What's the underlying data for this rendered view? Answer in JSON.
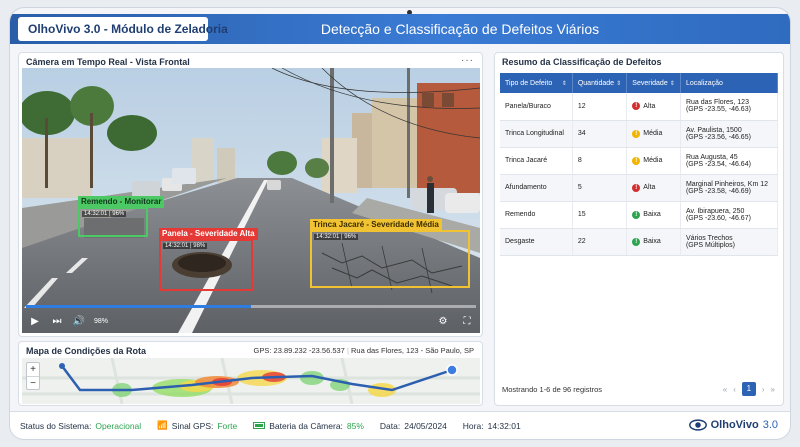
{
  "app": {
    "title": "OlhoVivo 3.0 - Módulo de Zeladoria",
    "page_title": "Detecção e Classificação de Defeitos Viários",
    "brand_name": "OlhoVivo",
    "brand_version": "3.0"
  },
  "camera": {
    "title": "Câmera em Tempo Real - Vista Frontal",
    "menu": "···",
    "volume": "98%",
    "progress_fraction": 0.5,
    "detections": [
      {
        "label": "Remendo - Monitorar",
        "timestamp": "14:32:01 | 96%",
        "color": "#4cc864"
      },
      {
        "label": "Panela - Severidade Alta",
        "timestamp": "14:32:01 | 98%",
        "color": "#e53935"
      },
      {
        "label": "Trinca Jacaré - Severidade Média",
        "timestamp": "14:32:01 | 96%",
        "color": "#f1c232"
      }
    ]
  },
  "map": {
    "title": "Mapa de Condições da Rota",
    "gps": "GPS: 23.89.232 -23.56.537",
    "address": "Rua das Flores, 123 - São Paulo, SP",
    "zoom_in": "+",
    "zoom_out": "−"
  },
  "summary": {
    "title": "Resumo da Classificação de Defeitos",
    "columns": [
      "Tipo de Defeito",
      "Quantidade",
      "Severidade",
      "Localização"
    ],
    "rows": [
      {
        "tipo": "Panela/Buraco",
        "qtd": "12",
        "sev": "Alta",
        "sev_color": "#d32f2f",
        "loc1": "Rua das Flores, 123",
        "loc2": "(GPS -23.55, -46.63)"
      },
      {
        "tipo": "Trinca Longitudinal",
        "qtd": "34",
        "sev": "Média",
        "sev_color": "#f1b400",
        "loc1": "Av. Paulista, 1500",
        "loc2": "(GPS -23.56, -46.65)"
      },
      {
        "tipo": "Trinca Jacaré",
        "qtd": "8",
        "sev": "Média",
        "sev_color": "#f1b400",
        "loc1": "Rua Augusta, 45",
        "loc2": "(GPS -23.54, -46.64)"
      },
      {
        "tipo": "Afundamento",
        "qtd": "5",
        "sev": "Alta",
        "sev_color": "#d32f2f",
        "loc1": "Marginal Pinheiros, Km 12",
        "loc2": "(GPS -23.58, -46.69)"
      },
      {
        "tipo": "Remendo",
        "qtd": "15",
        "sev": "Baixa",
        "sev_color": "#2ea44f",
        "loc1": "Av. Ibirapuera, 250",
        "loc2": "(GPS -23.60, -46.67)"
      },
      {
        "tipo": "Desgaste",
        "qtd": "22",
        "sev": "Baixa",
        "sev_color": "#2ea44f",
        "loc1": "Vários Trechos",
        "loc2": "(GPS Múltiplos)"
      }
    ],
    "footer": "Mostrando 1-6 de 96 registros",
    "pager": {
      "first": "«",
      "prev": "‹",
      "current": "1",
      "next": "›",
      "last": "»"
    }
  },
  "status": {
    "system_label": "Status do Sistema:",
    "system_value": "Operacional",
    "gps_label": "Sinal GPS:",
    "gps_value": "Forte",
    "battery_label": "Bateria da Câmera:",
    "battery_value": "85%",
    "date_label": "Data:",
    "date_value": "24/05/2024",
    "time_label": "Hora:",
    "time_value": "14:32:01"
  }
}
